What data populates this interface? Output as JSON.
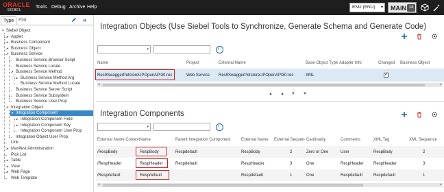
{
  "topbar": {
    "logo_oracle": "ORACLE",
    "logo_siebel": "SIEBEL",
    "menu": [
      "Tools",
      "Debug",
      "Archive",
      "Help"
    ],
    "locale": "ENU (ENU)",
    "main_label": "MAIN",
    "main_count": "14",
    "icons": [
      "cube-icon",
      "wand-icon"
    ]
  },
  "leftpanel": {
    "tabs": [
      "Type",
      "Flat"
    ],
    "tree": [
      {
        "label": "Siebel Object",
        "arrow": "▾",
        "indent": 0
      },
      {
        "label": "Applet",
        "arrow": "▸",
        "indent": 1
      },
      {
        "label": "Business Component",
        "arrow": "▸",
        "indent": 1
      },
      {
        "label": "Business Object",
        "arrow": "▸",
        "indent": 1
      },
      {
        "label": "Business Service",
        "arrow": "▾",
        "indent": 1
      },
      {
        "label": "Business Service Browser Script",
        "arrow": "",
        "indent": 2
      },
      {
        "label": "Business Service Locale",
        "arrow": "",
        "indent": 2
      },
      {
        "label": "Business Service Method",
        "arrow": "▾",
        "indent": 2
      },
      {
        "label": "Business Service Method Arg",
        "arrow": "▸",
        "indent": 3
      },
      {
        "label": "Business Service Method Locale",
        "arrow": "",
        "indent": 3
      },
      {
        "label": "Business Service Server Script",
        "arrow": "",
        "indent": 2
      },
      {
        "label": "Business Service Subsystem",
        "arrow": "",
        "indent": 2
      },
      {
        "label": "Business Service User Prop",
        "arrow": "",
        "indent": 2
      },
      {
        "label": "Integration Object",
        "arrow": "▾",
        "indent": 1
      },
      {
        "label": "Integration Component",
        "arrow": "▾",
        "indent": 2,
        "selected": true
      },
      {
        "label": "Integration Component Field",
        "arrow": "▸",
        "indent": 3
      },
      {
        "label": "Integration Component Key",
        "arrow": "▸",
        "indent": 3
      },
      {
        "label": "Integration Component User Prop",
        "arrow": "",
        "indent": 3
      },
      {
        "label": "Integration Object User Prop",
        "arrow": "",
        "indent": 2
      },
      {
        "label": "Link",
        "arrow": "",
        "indent": 1
      },
      {
        "label": "Manifest Administration",
        "arrow": "▸",
        "indent": 1
      },
      {
        "label": "Pick List",
        "arrow": "",
        "indent": 1
      },
      {
        "label": "Table",
        "arrow": "▸",
        "indent": 1
      },
      {
        "label": "View",
        "arrow": "▸",
        "indent": 1
      },
      {
        "label": "Web Page",
        "arrow": "▸",
        "indent": 1
      },
      {
        "label": "Web Template",
        "arrow": "",
        "indent": 1
      }
    ]
  },
  "io": {
    "title": "Integration Objects (Use Siebel Tools to Synchronize, Generate Schema and Generate Code)",
    "columns": [
      "Name",
      "Project",
      "External Name",
      "Base Object Type",
      "Adapter Info",
      "Changed",
      "Business Object"
    ],
    "row": {
      "name": "Res9SwaggerPetstoreUPOpenAPI30:res",
      "project": "Web Service",
      "external_name": "Res9SwaggerPetstoreUPOpenAPI30:res",
      "base_object_type": "XML",
      "adapter_info": "",
      "changed": true,
      "business_object": ""
    },
    "nav_arrows": [
      "▲",
      "▲",
      "▼",
      "▼"
    ]
  },
  "ic": {
    "title": "Integration Components",
    "columns": [
      "External Name Context",
      "Name",
      "Parent Integration Component",
      "External Name",
      "External Sequence",
      "Cardinality",
      "Comments",
      "XML Tag",
      "XML Sequence"
    ],
    "rows": [
      {
        "ext_context": "/RespBody",
        "name": "RespBody",
        "parent": "Respdefault",
        "external_name": "RespBody",
        "ext_seq": "2",
        "cardinality": "Zero or One",
        "comments": "User",
        "xml_tag": "RespBody",
        "xml_seq": "2"
      },
      {
        "ext_context": "/RespHeader",
        "name": "RespHeader",
        "parent": "Respdefault",
        "external_name": "RespHeader",
        "ext_seq": "3",
        "cardinality": "One",
        "comments": "RespHeader",
        "xml_tag": "RespHeader",
        "xml_seq": "3"
      },
      {
        "ext_context": "/Respdefault",
        "name": "Respdefault",
        "parent": "",
        "external_name": "Respdefault",
        "ext_seq": "1",
        "cardinality": "One",
        "comments": "Respdefault",
        "xml_tag": "Respdefault",
        "xml_seq": "1"
      }
    ]
  },
  "colors": {
    "topbar": "#1e1e1e",
    "oracle_red": "#e8321e",
    "selection_blue": "#3a87c8",
    "link_blue": "#1a5fb4",
    "highlight_red": "#d42020",
    "selected_row": "#dbe9f6"
  },
  "icons": {
    "add": "plus-icon",
    "delete": "trash-icon",
    "settings": "gear-icon",
    "go": "arrow-right-circle-icon",
    "edit": "pencil-icon",
    "collapse": "double-chevron-left-icon"
  }
}
